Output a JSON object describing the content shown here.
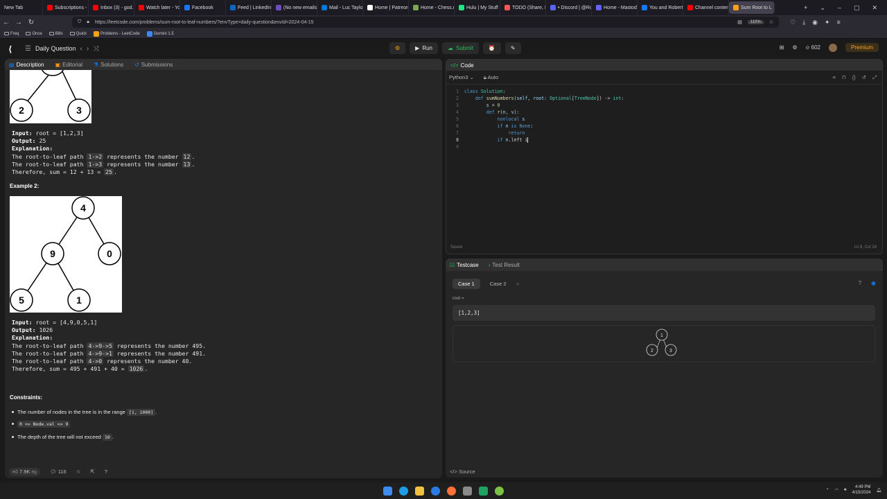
{
  "browser": {
    "tabs": [
      {
        "label": "New Tab",
        "color": "#555555"
      },
      {
        "label": "Subscriptions - Y",
        "color": "#ff0000"
      },
      {
        "label": "Inbox (3) - god...",
        "color": "#ff0000"
      },
      {
        "label": "Watch later - You",
        "color": "#ff0000"
      },
      {
        "label": "Facebook",
        "color": "#1877f2"
      },
      {
        "label": "Feed | LinkedIn",
        "color": "#0a66c2"
      },
      {
        "label": "(No new emails)",
        "color": "#6b4fbb"
      },
      {
        "label": "Mail - Luc Taylor",
        "color": "#0078d4"
      },
      {
        "label": "Home | Patreon",
        "color": "#ffffff"
      },
      {
        "label": "Home - Chess.c",
        "color": "#7fa650"
      },
      {
        "label": "Hulu | My Stuff",
        "color": "#1ce783"
      },
      {
        "label": "TODO (Share, Rj",
        "color": "#ff5555"
      },
      {
        "label": "• Discord | @Rob",
        "color": "#5865f2"
      },
      {
        "label": "Home - Mastod",
        "color": "#6364ff"
      },
      {
        "label": "You and Robert",
        "color": "#1877f2"
      },
      {
        "label": "Channel content",
        "color": "#ff0000"
      },
      {
        "label": "Sum Root to L",
        "color": "#ffa116",
        "active": true
      }
    ],
    "url": "https://leetcode.com/problems/sum-root-to-leaf-numbers/?envType=daily-question&envId=2024-04-15",
    "zoom": "110%",
    "bookmarks": [
      "Freq",
      "Once",
      "Bills",
      "Quick",
      "Problems - LeetCode",
      "Gemini 1.5"
    ]
  },
  "lc_header": {
    "daily": "Daily Question",
    "run": "Run",
    "submit": "Submit",
    "coins": "602",
    "premium": "Premium"
  },
  "left_tabs": [
    "Description",
    "Editorial",
    "Solutions",
    "Submissions"
  ],
  "example1": {
    "input": "root = [1,2,3]",
    "output": "25",
    "lines": [
      [
        "The root-to-leaf path ",
        "1->2",
        " represents the number ",
        "12",
        "."
      ],
      [
        "The root-to-leaf path ",
        "1->3",
        " represents the number ",
        "13",
        "."
      ],
      [
        "Therefore, sum = 12 + 13 = ",
        "25",
        "."
      ]
    ],
    "nodes": [
      "2",
      "3"
    ]
  },
  "example2": {
    "heading": "Example 2:",
    "input": "root = [4,9,0,5,1]",
    "output": "1026",
    "lines": [
      [
        "The root-to-leaf path ",
        "4->9->5",
        " represents the number 495."
      ],
      [
        "The root-to-leaf path ",
        "4->9->1",
        " represents the number 491."
      ],
      [
        "The root-to-leaf path ",
        "4->0",
        " represents the number 40."
      ],
      [
        "Therefore, sum = 495 + 491 + 40 = ",
        "1026",
        "."
      ]
    ],
    "nodes": [
      "4",
      "9",
      "0",
      "5",
      "1"
    ]
  },
  "labels": {
    "input": "Input:",
    "output": "Output:",
    "explanation": "Explanation:"
  },
  "constraints": {
    "heading": "Constraints:",
    "items": [
      [
        "The number of nodes in the tree is in the range ",
        "[1, 1000]",
        "."
      ],
      [
        "",
        "0 <= Node.val <= 9",
        ""
      ],
      [
        "The depth of the tree will not exceed ",
        "10",
        "."
      ]
    ]
  },
  "footer": {
    "likes": "7.9K",
    "comments": "116"
  },
  "code_panel": {
    "tab": "Code",
    "language": "Python3",
    "mode": "Auto",
    "status": "Saved",
    "cursor": "Ln 8, Col 24",
    "lines": [
      "class Solution:",
      "    def sumNumbers(self, root: Optional[TreeNode]) -> int:",
      "        s = 0",
      "        def r(n, v):",
      "            nonlocal s",
      "            if n is None:",
      "                return",
      "            if n.left i",
      ""
    ]
  },
  "test_panel": {
    "tabs": [
      "Testcase",
      "Test Result"
    ],
    "cases": [
      "Case 1",
      "Case 2"
    ],
    "root_label": "root =",
    "root_value": "[1,2,3]",
    "tree_nodes": [
      "1",
      "2",
      "3"
    ],
    "source": "Source"
  },
  "taskbar": {
    "time": "4:49 PM",
    "date": "4/15/2024"
  }
}
